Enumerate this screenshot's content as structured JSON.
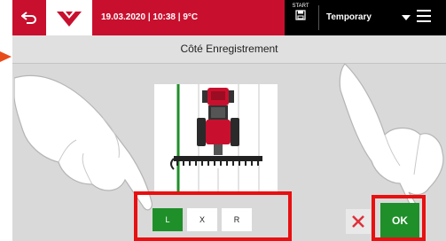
{
  "header": {
    "datetime_temp": "19.03.2020 | 10:38 | 9°C",
    "start_label": "START",
    "mode_label": "Temporary"
  },
  "icons": {
    "back": "back-arrow-icon",
    "logo": "brand-triangle-logo",
    "start": "save-disk-icon",
    "dropdown": "chevron-down-icon",
    "menu": "hamburger-menu-icon",
    "cancel": "close-icon"
  },
  "screen": {
    "title": "Côté Enregistrement"
  },
  "side_options": [
    {
      "label": "L",
      "selected": true
    },
    {
      "label": "X",
      "selected": false
    },
    {
      "label": "R",
      "selected": false
    }
  ],
  "actions": {
    "ok_label": "OK"
  },
  "colors": {
    "brand_red": "#c8102e",
    "selected_green": "#1f8f2a",
    "highlight_red": "#e81010",
    "pointer_orange": "#e84b1a"
  }
}
